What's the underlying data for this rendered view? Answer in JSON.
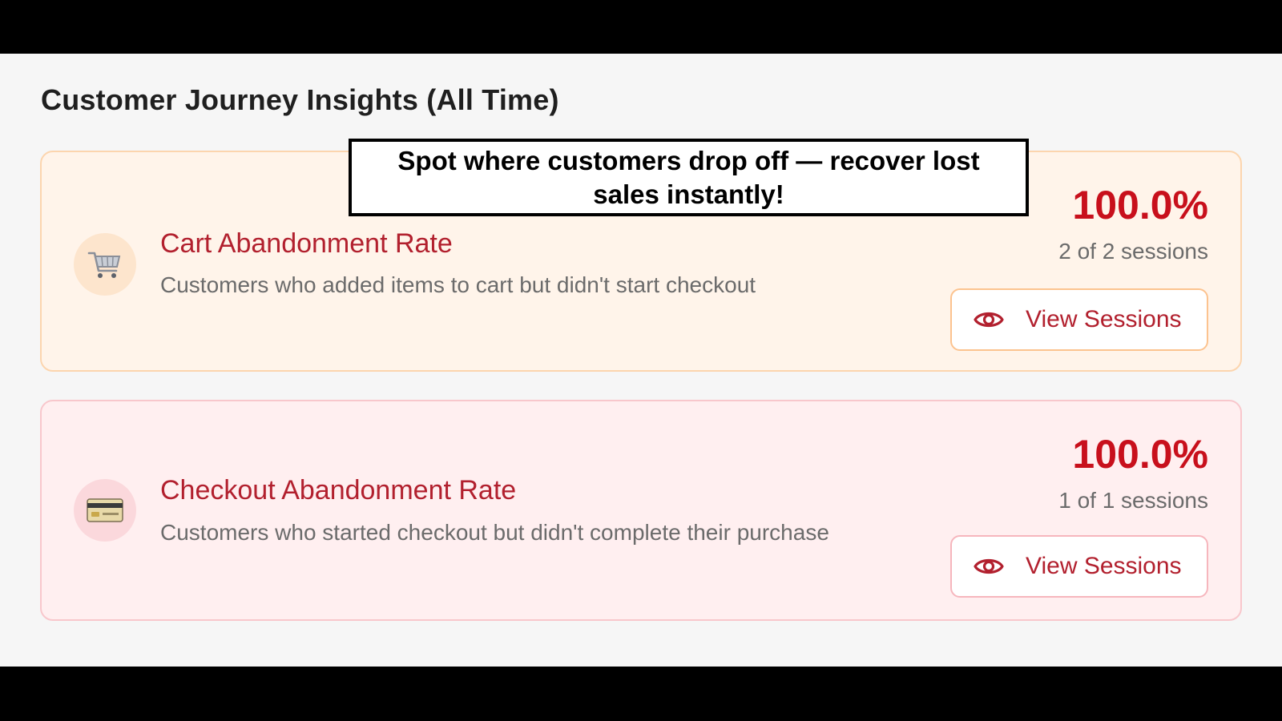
{
  "page": {
    "title": "Customer Journey Insights (All Time)"
  },
  "callout": {
    "text": "Spot where customers drop off — recover lost sales instantly!"
  },
  "metrics": [
    {
      "icon": "shopping-cart-icon",
      "title": "Cart Abandonment Rate",
      "description": "Customers who added items to cart but didn't start checkout",
      "value": "100.0%",
      "sessions": "2 of 2 sessions",
      "button_label": "View Sessions",
      "button_icon": "eye-icon"
    },
    {
      "icon": "credit-card-icon",
      "title": "Checkout Abandonment Rate",
      "description": "Customers who started checkout but didn't complete their purchase",
      "value": "100.0%",
      "sessions": "1 of 1 sessions",
      "button_label": "View Sessions",
      "button_icon": "eye-icon"
    }
  ],
  "colors": {
    "accent_red": "#c8101c",
    "title_red": "#b2202e",
    "cart_card_bg": "#fff4ea",
    "checkout_card_bg": "#ffeff0",
    "page_bg": "#f6f6f6"
  }
}
